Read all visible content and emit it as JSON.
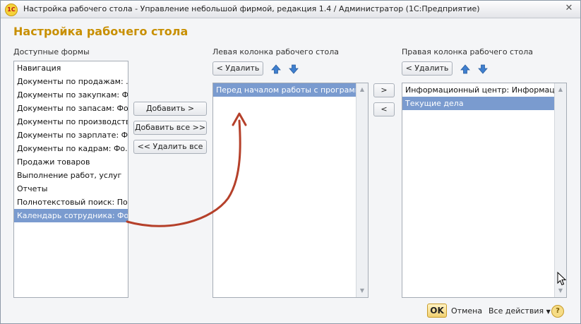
{
  "window": {
    "title": "Настройка рабочего стола - Управление небольшой фирмой, редакция 1.4 / Администратор  (1С:Предприятие)",
    "app_icon_text": "1С",
    "close_glyph": "✕"
  },
  "form": {
    "title": "Настройка рабочего стола"
  },
  "available": {
    "label": "Доступные формы",
    "items": [
      "Навигация",
      "Документы по продажам: ...",
      "Документы по закупкам: Ф...",
      "Документы по запасам: Фо...",
      "Документы по производств...",
      "Документы по зарплате: Ф...",
      "Документы по кадрам: Фо...",
      "Продажи товаров",
      "Выполнение работ, услуг",
      "Отчеты",
      "Полнотекстовый поиск: По...",
      "Календарь сотрудника: Фо..."
    ],
    "selected_index": 11
  },
  "middle_buttons": {
    "add": "Добавить >",
    "add_all": "Добавить все >>",
    "remove_all": "<< Удалить все"
  },
  "left_column": {
    "label": "Левая колонка рабочего стола",
    "remove_button": "< Удалить",
    "items": [
      "Перед началом работы с программой"
    ],
    "selected_index": 0
  },
  "transfer_buttons": {
    "right": ">",
    "left": "<"
  },
  "right_column": {
    "label": "Правая колонка рабочего стола",
    "remove_button": "< Удалить",
    "items": [
      "Информационный центр: Информацио...",
      "Текущие дела"
    ],
    "selected_index": 1
  },
  "footer": {
    "ok": "OK",
    "cancel": "Отмена",
    "all_actions": "Все действия",
    "help": "?"
  },
  "colors": {
    "title_accent": "#c88f00",
    "selection": "#7a9bcf",
    "annotation_arrow": "#b5402a",
    "move_arrow": "#3f7fcf"
  }
}
